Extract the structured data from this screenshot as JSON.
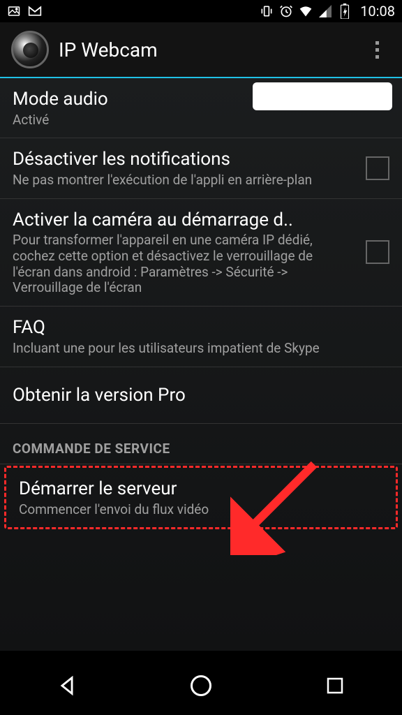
{
  "status_bar": {
    "time": "10:08"
  },
  "action_bar": {
    "title": "IP Webcam"
  },
  "settings": {
    "audio_mode": {
      "title": "Mode audio",
      "sub": "Activé"
    },
    "disable_notif": {
      "title": "Désactiver les notifications",
      "sub": "Ne pas montrer l'exécution de l'appli en arrière-plan",
      "checked": false
    },
    "start_cam": {
      "title": "Activer la caméra au démarrage d..",
      "sub": "Pour transformer l'appareil en une caméra IP dédié, cochez cette option et désactivez le verrouillage de l'écran dans android : Paramètres -> Sécurité -> Verrouillage de l'écran",
      "checked": false
    },
    "faq": {
      "title": "FAQ",
      "sub": "Incluant une pour les utilisateurs impatient de Skype"
    },
    "get_pro": {
      "title": "Obtenir la version Pro"
    },
    "section_service": "COMMANDE DE SERVICE",
    "start_server": {
      "title": "Démarrer le serveur",
      "sub": "Commencer l'envoi du flux vidéo"
    }
  }
}
